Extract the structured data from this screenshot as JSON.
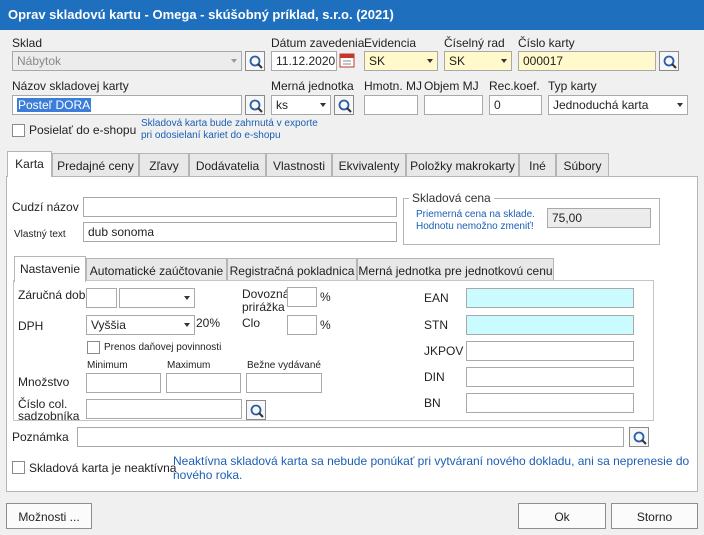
{
  "window": {
    "title": "Oprav skladovú kartu - Omega - skúšobný príklad, s.r.o. (2021)"
  },
  "header": {
    "sklad": {
      "label": "Sklad",
      "value": "Nábytok"
    },
    "datum": {
      "label": "Dátum zavedenia",
      "value": "11.12.2020"
    },
    "evidencia": {
      "label": "Evidencia",
      "value": "SK"
    },
    "ciselny_rad": {
      "label": "Číselný rad",
      "value": "SK"
    },
    "cislo_karty": {
      "label": "Číslo karty",
      "value": "000017"
    },
    "nazov": {
      "label": "Názov skladovej karty",
      "value": "Posteľ DORA"
    },
    "merna_jednotka": {
      "label": "Merná jednotka",
      "value": "ks"
    },
    "hmotn": {
      "label": "Hmotn. MJ",
      "value": ""
    },
    "objem": {
      "label": "Objem MJ",
      "value": ""
    },
    "rec_koef": {
      "label": "Rec.koef.",
      "value": "0"
    },
    "typ_karty": {
      "label": "Typ karty",
      "value": "Jednoduchá karta"
    },
    "eshop": {
      "label": "Posielať do e-shopu",
      "note1": "Skladová karta bude zahrnutá v exporte",
      "note2": "pri odosielaní kariet do e-shopu"
    }
  },
  "tabs": [
    "Karta",
    "Predajné ceny",
    "Zľavy",
    "Dodávatelia",
    "Vlastnosti",
    "Ekvivalenty",
    "Položky makrokarty",
    "Iné",
    "Súbory"
  ],
  "karta": {
    "cudzi_nazov": {
      "label": "Cudzí názov",
      "value": ""
    },
    "vlastny_text": {
      "label": "Vlastný text",
      "value": "dub sonoma"
    },
    "skladova_cena": {
      "title": "Skladová cena",
      "note1": "Priemerná cena na sklade.",
      "note2": "Hodnotu nemožno zmeniť!",
      "value": "75,00"
    }
  },
  "subtabs": [
    "Nastavenie",
    "Automatické zaúčtovanie",
    "Registračná pokladnica",
    "Merná jednotka pre jednotkovú cenu"
  ],
  "nastavenie": {
    "zarucna_doba": {
      "label": "Záručná doba",
      "value": "",
      "unit": ""
    },
    "dovozna": {
      "label1": "Dovozná",
      "label2": "prirážka",
      "value": "",
      "pct": "%"
    },
    "dph": {
      "label": "DPH",
      "value": "Vyššia",
      "rate": "20%"
    },
    "clo": {
      "label": "Clo",
      "value": "",
      "pct": "%"
    },
    "prenos": {
      "label": "Prenos daňovej povinnosti"
    },
    "mnozstvo": {
      "label": "Množstvo",
      "min_label": "Minimum",
      "max_label": "Maximum",
      "bezne_label": "Bežne vydávané",
      "min": "",
      "max": "",
      "bezne": ""
    },
    "colny": {
      "label1": "Číslo col.",
      "label2": "sadzobníka",
      "value": ""
    },
    "ean": {
      "label": "EAN",
      "value": ""
    },
    "stn": {
      "label": "STN",
      "value": ""
    },
    "jkpov": {
      "label": "JKPOV",
      "value": ""
    },
    "din": {
      "label": "DIN",
      "value": ""
    },
    "bn": {
      "label": "BN",
      "value": ""
    }
  },
  "poznamka": {
    "label": "Poznámka",
    "value": ""
  },
  "neaktivna": {
    "label": "Skladová karta je neaktívna",
    "note1": "Neaktívna skladová karta sa nebude ponúkať pri vytváraní nového dokladu, ani sa neprenesie do",
    "note2": "nového roka."
  },
  "buttons": {
    "moznosti": "Možnosti ...",
    "ok": "Ok",
    "storno": "Storno"
  },
  "colors": {
    "title_bar": "#1e6fbe",
    "highlight": "#fff9cc",
    "cyan": "#c9fbff",
    "note": "#1a5fb4"
  }
}
